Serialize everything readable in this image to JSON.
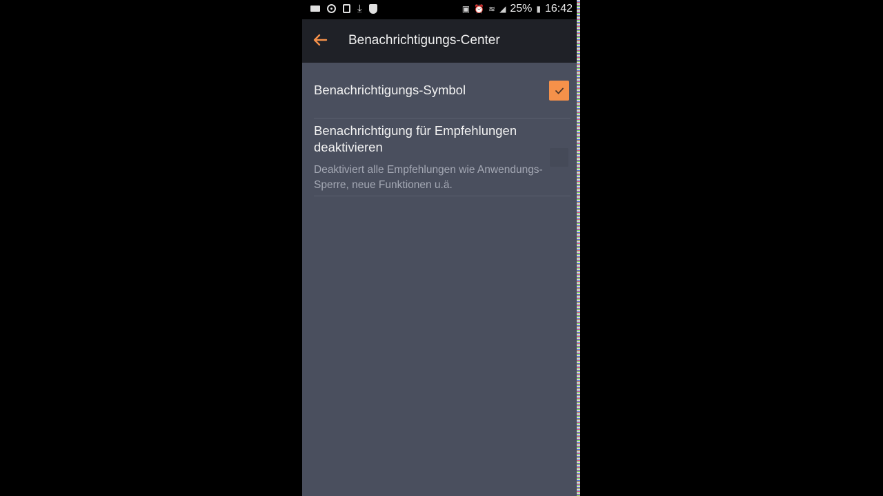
{
  "status_bar": {
    "battery": "25%",
    "time": "16:42"
  },
  "toolbar": {
    "title": "Benachrichtigungs-Center"
  },
  "settings": [
    {
      "label": "Benachrichtigungs-Symbol",
      "checked": true
    },
    {
      "label": "Benachrichtigung für Empfehlungen deaktivieren",
      "summary": "Deaktiviert alle Empfehlungen wie Anwendungs-Sperre, neue Funktionen u.ä.",
      "checked": false
    }
  ],
  "colors": {
    "accent": "#f5914a",
    "toolbar_bg": "#1f2127",
    "content_bg": "#4a4f5e"
  },
  "icons": {
    "back": "arrow-left-icon",
    "check": "checkmark-icon"
  }
}
